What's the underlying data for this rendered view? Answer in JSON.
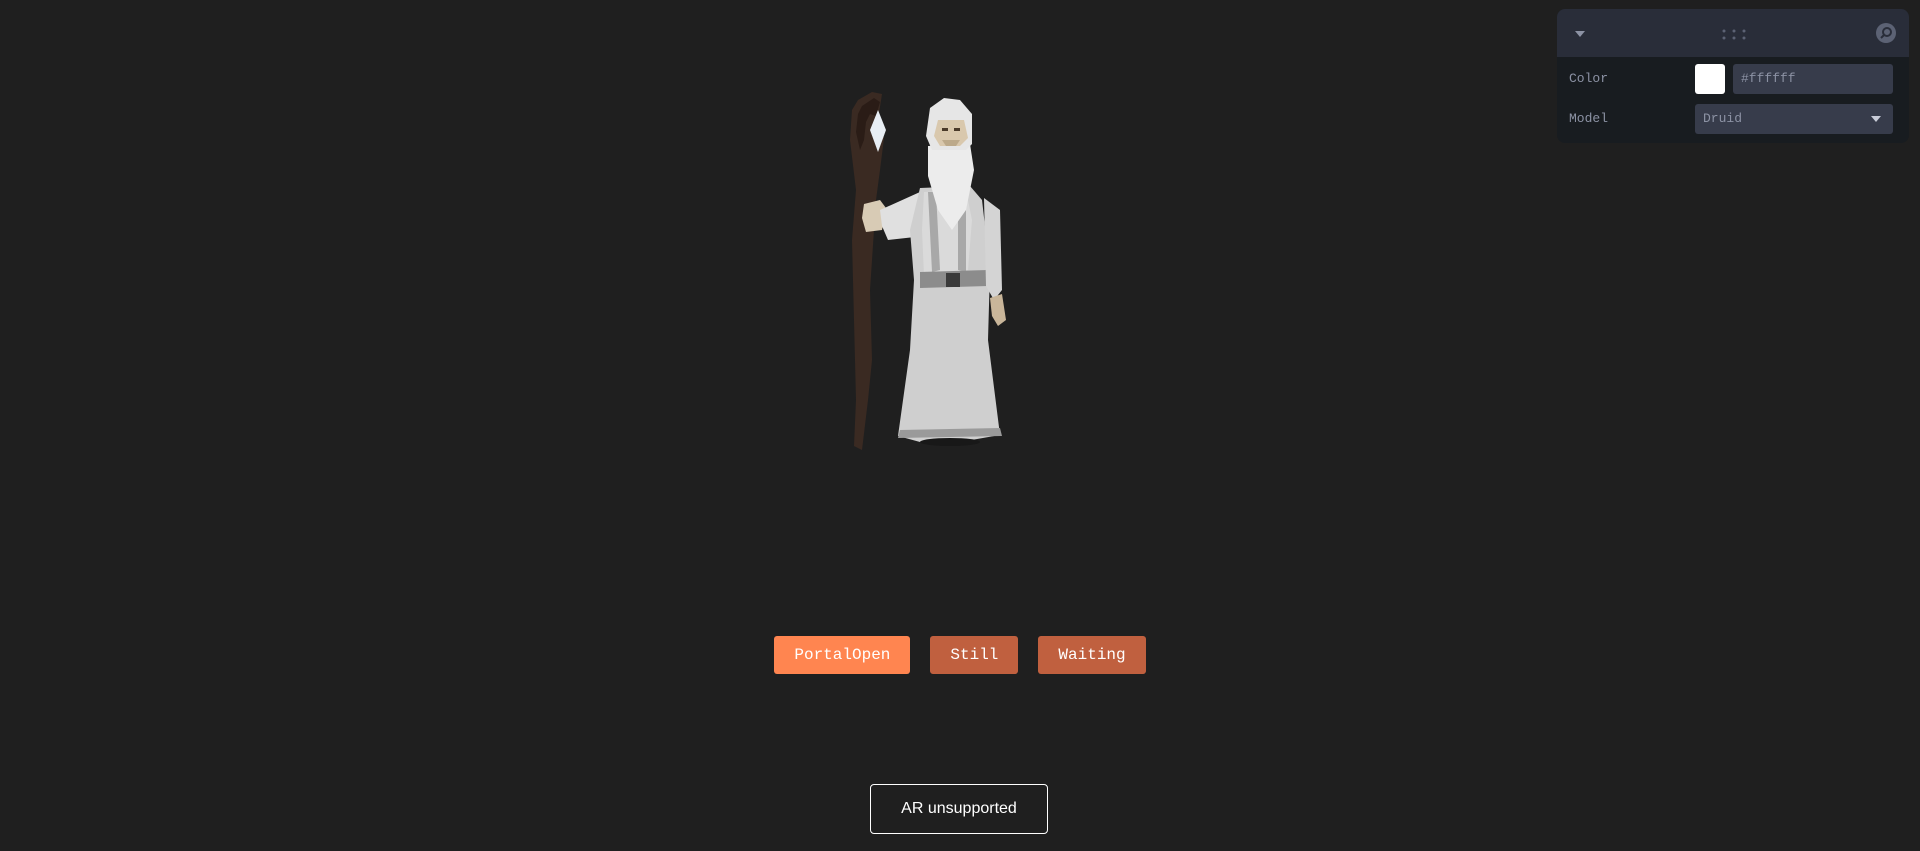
{
  "animations": {
    "buttons": [
      {
        "label": "PortalOpen",
        "state": "active"
      },
      {
        "label": "Still",
        "state": "inactive"
      },
      {
        "label": "Waiting",
        "state": "inactive"
      }
    ]
  },
  "ar_button": {
    "label": "AR unsupported"
  },
  "controls": {
    "color": {
      "label": "Color",
      "value": "#ffffff"
    },
    "model": {
      "label": "Model",
      "value": "Druid"
    }
  },
  "icons": {
    "collapse": "chevron-down-icon",
    "drag": "drag-handle-icon",
    "search": "search-icon"
  },
  "colors": {
    "background": "#1f1f1f",
    "button_active": "#ff8550",
    "button_inactive": "#c0603f",
    "panel": "#181c20",
    "panel_header": "#292d39",
    "input": "#373c4b"
  }
}
